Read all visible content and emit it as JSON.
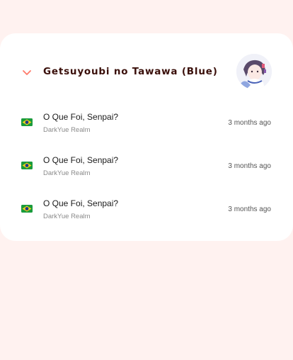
{
  "manga": {
    "title": "Getsuyoubi no Tawawa (Blue)",
    "cover_icon": "manga-cover-thumbnail",
    "toggle_icon": "chevron-down-icon",
    "accent_color": "#ff7a6b"
  },
  "chapters": [
    {
      "title": "O Que Foi, Senpai?",
      "group": "DarkYue Realm",
      "time": "3 months ago",
      "flag_icon": "brazil-flag-icon"
    },
    {
      "title": "O Que Foi, Senpai?",
      "group": "DarkYue Realm",
      "time": "3 months ago",
      "flag_icon": "brazil-flag-icon"
    },
    {
      "title": "O Que Foi, Senpai?",
      "group": "DarkYue Realm",
      "time": "3 months ago",
      "flag_icon": "brazil-flag-icon"
    }
  ]
}
